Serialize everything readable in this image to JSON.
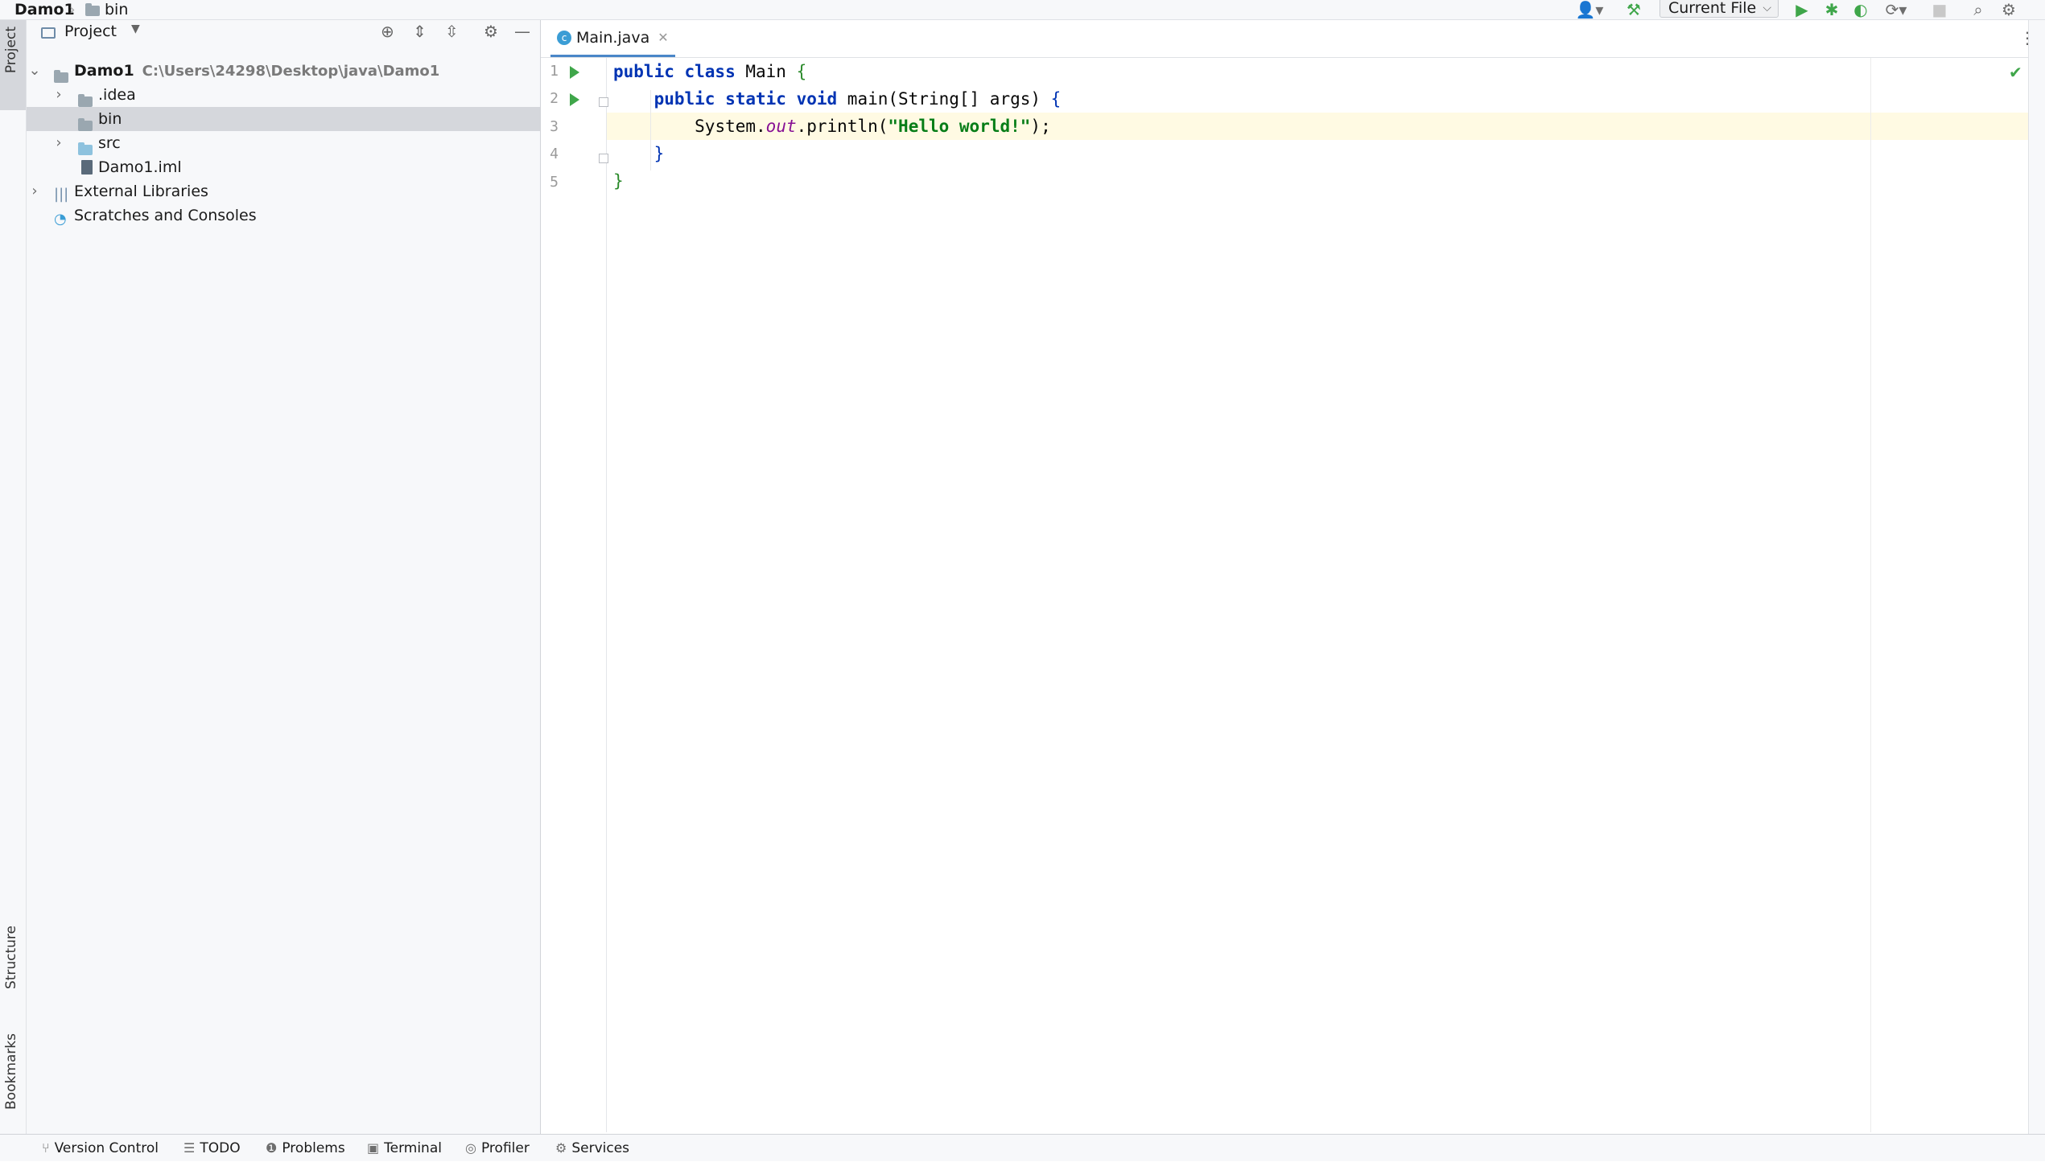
{
  "breadcrumb": {
    "project": "Damo1",
    "folder": "bin"
  },
  "toolbar": {
    "run_config": "Current File",
    "account_icon": "person-icon",
    "build_icon": "hammer-icon",
    "run_icon": "run-icon",
    "debug_icon": "debug-icon",
    "coverage_icon": "coverage-icon",
    "profile_icon": "profile-icon",
    "stop_icon": "stop-icon",
    "search_icon": "search-icon",
    "settings_icon": "gear-icon"
  },
  "left_strip": {
    "project_tab": "Project",
    "structure_tab": "Structure",
    "bookmarks_tab": "Bookmarks"
  },
  "project_panel": {
    "title": "Project",
    "tree": [
      {
        "label": "Damo1",
        "path": "C:\\Users\\24298\\Desktop\\java\\Damo1",
        "expanded": true
      },
      {
        "label": ".idea",
        "expanded": false
      },
      {
        "label": "bin",
        "selected": true
      },
      {
        "label": "src",
        "expanded": false
      },
      {
        "label": "Damo1.iml"
      },
      {
        "label": "External Libraries",
        "expanded": false
      },
      {
        "label": "Scratches and Consoles"
      }
    ]
  },
  "editor": {
    "tab_label": "Main.java",
    "line_numbers": [
      "1",
      "2",
      "3",
      "4",
      "5"
    ],
    "code": {
      "line1": {
        "kw": "public class",
        "name": " Main ",
        "brace": "{"
      },
      "line2": {
        "indent": "    ",
        "kw": "public static void",
        "rest": " main(String[] args) ",
        "brace": "{"
      },
      "line3": {
        "indent": "        ",
        "pre": "System.",
        "field": "out",
        "mid": ".println(",
        "str": "\"Hello world!\"",
        "end": ");"
      },
      "line4": {
        "indent": "    ",
        "brace": "}"
      },
      "line5": {
        "brace": "}"
      }
    }
  },
  "bottom_tabs": [
    "Version Control",
    "TODO",
    "Problems",
    "Terminal",
    "Profiler",
    "Services"
  ],
  "colors": {
    "keyword": "#0033b3",
    "string": "#067d17",
    "field": "#871094",
    "run": "#3fa64a",
    "current_line": "#fffae3"
  }
}
